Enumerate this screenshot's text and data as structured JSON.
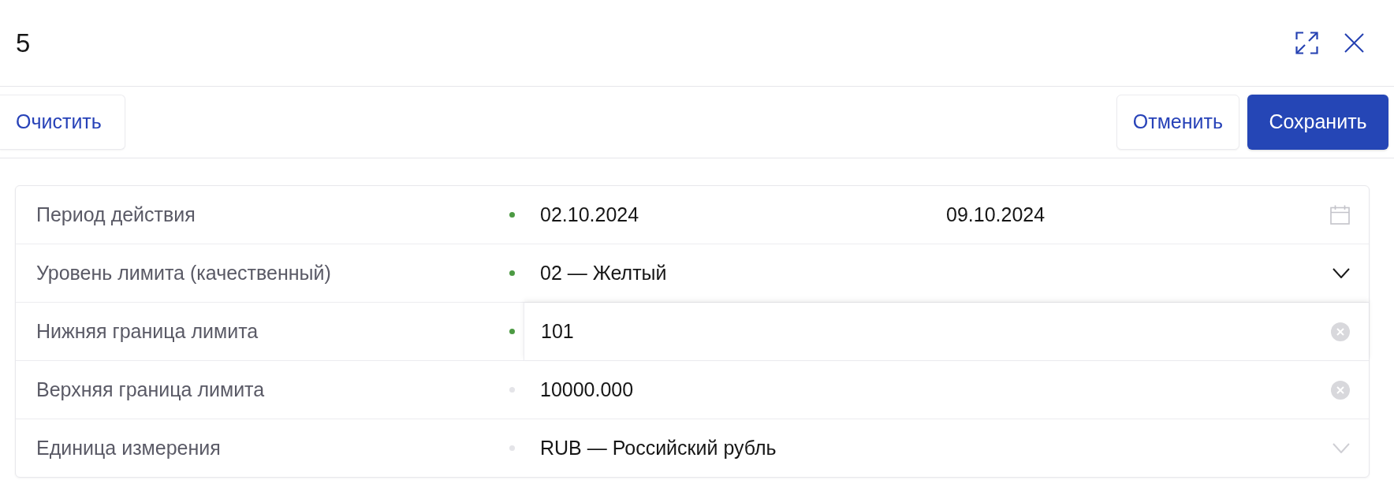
{
  "header": {
    "title": "5"
  },
  "toolbar": {
    "left_buttons": [
      {
        "label": "Очистить",
        "kind": "secondary"
      }
    ],
    "right_buttons": [
      {
        "label": "Отменить",
        "kind": "secondary"
      },
      {
        "label": "Сохранить",
        "kind": "primary"
      }
    ]
  },
  "form": {
    "rows": [
      {
        "kind": "date_range",
        "label": "Период действия",
        "color": "#4c9a43",
        "from": "02.10.2024",
        "to": "09.10.2024"
      },
      {
        "kind": "select",
        "label": "Уровень лимита (качественный)",
        "color": "#4c9a43",
        "value": "02 — Желтый",
        "disabled": false
      },
      {
        "kind": "input",
        "label": "Нижняя граница лимита",
        "color": "#4c9a43",
        "value": "101",
        "focused": true
      },
      {
        "kind": "input",
        "label": "Верхняя граница лимита",
        "color": "#e4e4e8",
        "value": "10000.000",
        "focused": false
      },
      {
        "kind": "select",
        "label": "Единица измерения",
        "color": "#e4e4e8",
        "value": "RUB — Российский рубль",
        "disabled": true
      }
    ]
  }
}
